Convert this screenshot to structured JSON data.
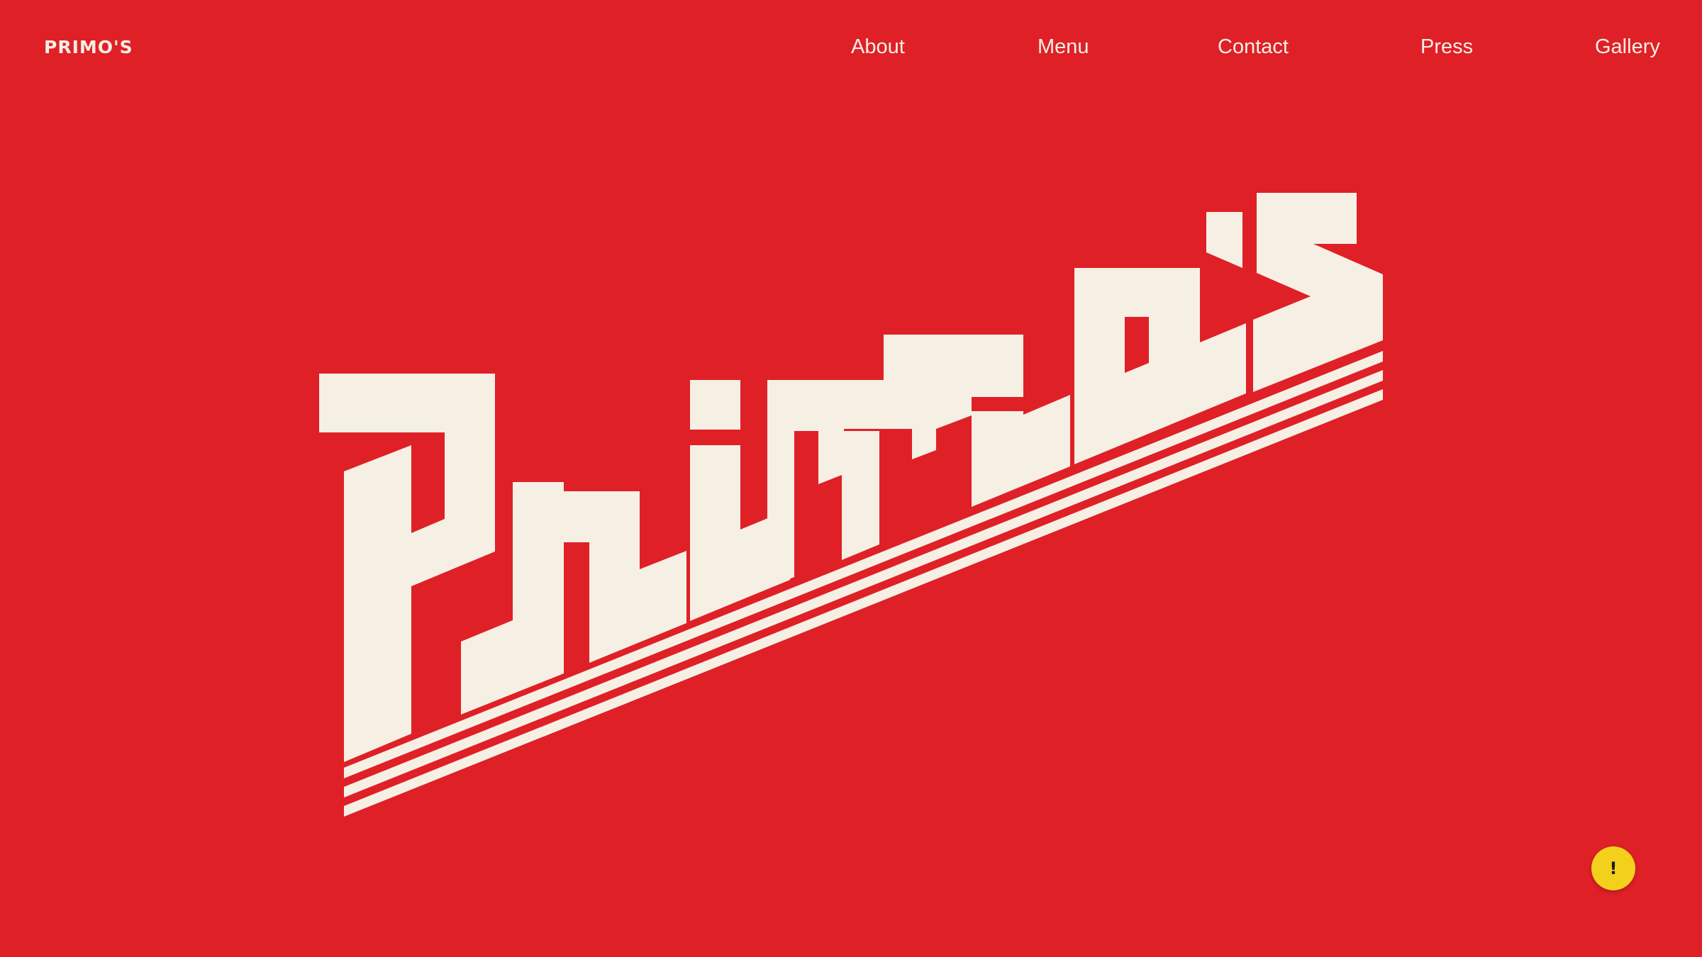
{
  "header": {
    "brand": "PRIMO'S",
    "nav": [
      {
        "label": "About"
      },
      {
        "label": "Menu"
      },
      {
        "label": "Contact"
      },
      {
        "label": "Press"
      },
      {
        "label": "Gallery"
      }
    ]
  },
  "hero": {
    "logo_wordmark": "Primo's",
    "logo_icon": "primos-slanted-wordmark"
  },
  "alert_button": {
    "symbol": "!",
    "icon": "exclamation-icon",
    "color": "#f2d01c"
  },
  "colors": {
    "background": "#df2027",
    "foreground": "#f6efe4"
  }
}
